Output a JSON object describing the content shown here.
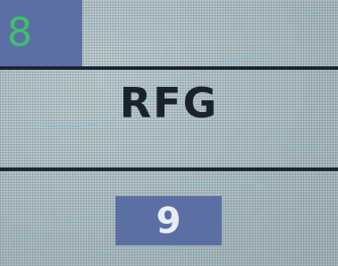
{
  "top_indicator": {
    "value": "8"
  },
  "title": {
    "text": "RFG"
  },
  "value_display": {
    "value": "9"
  },
  "colors": {
    "panel_blue": "#5c6fa5",
    "indicator_green": "#3cc26a",
    "background": "#b6c5c9",
    "divider": "#1b2430"
  }
}
